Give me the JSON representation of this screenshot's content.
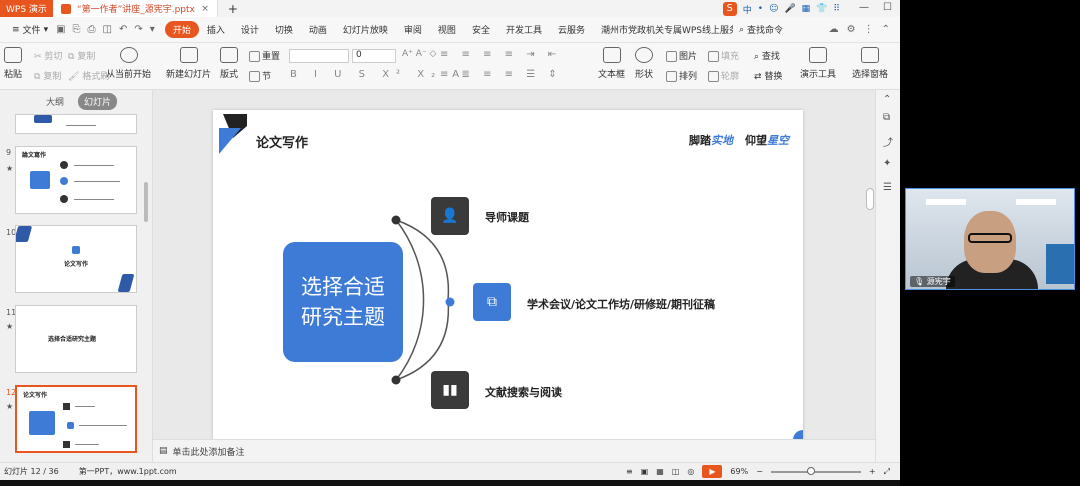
{
  "titlebar": {
    "app_name": "WPS 演示",
    "doc_tab": "“第一作者”讲座_源宪宇.pptx",
    "new_tab": "+",
    "ime_items": [
      "中",
      "•",
      "☺",
      "🎤",
      "▦",
      "👕",
      "⠿"
    ],
    "ime_badge": "S"
  },
  "menubar": {
    "file": "文件",
    "tabs": [
      "开始",
      "插入",
      "设计",
      "切换",
      "动画",
      "幻灯片放映",
      "审阅",
      "视图",
      "安全",
      "开发工具",
      "云服务",
      "潮州市党政机关专属WPS线上服务通道"
    ],
    "active_tab": "开始",
    "search": "查找命令"
  },
  "toolbar": {
    "paste": "粘贴",
    "cut": "剪切",
    "copy": "复制",
    "format_painter": "格式刷",
    "from_current": "从当前开始",
    "new_slide": "新建幻灯片",
    "layout": "版式",
    "reset": "重置",
    "section": "节",
    "font_size": "0",
    "textbox": "文本框",
    "shape": "形状",
    "picture": "图片",
    "fill": "填充",
    "arrange": "排列",
    "outline": "轮廓",
    "find": "查找",
    "replace": "替换",
    "presentation_tools": "演示工具",
    "selection_pane": "选择窗格"
  },
  "leftpanel": {
    "tab_outline": "大纲",
    "tab_slides": "幻灯片",
    "thumbs": [
      {
        "no": "",
        "title": ""
      },
      {
        "no": "9",
        "title": "論文寫作"
      },
      {
        "no": "10",
        "title": "论文写作"
      },
      {
        "no": "11",
        "title": "选择合适研究主题"
      },
      {
        "no": "12",
        "title": "论文写作"
      }
    ]
  },
  "slide": {
    "title": "论文写作",
    "motto_1": "脚踏",
    "motto_1_blue": "实地",
    "motto_2": "仰望",
    "motto_2_blue": "星空",
    "main_line1": "选择合适",
    "main_line2": "研究主题",
    "items": [
      {
        "text": "导师课题"
      },
      {
        "text": "学术会议/论文工作坊/研修班/期刊征稿"
      },
      {
        "text": "文献搜索与阅读"
      }
    ]
  },
  "notes": {
    "placeholder": "单击此处添加备注"
  },
  "status": {
    "slide_info": "幻灯片 12 / 36",
    "theme": "第一PPT，www.1ppt.com",
    "zoom": "69%",
    "minus": "−",
    "plus": "+"
  },
  "webcam": {
    "name": "源宪宇"
  },
  "colors": {
    "accent": "#e8561f",
    "slide_blue": "#3d7bd6",
    "dark_icon": "#3a3a3a"
  }
}
